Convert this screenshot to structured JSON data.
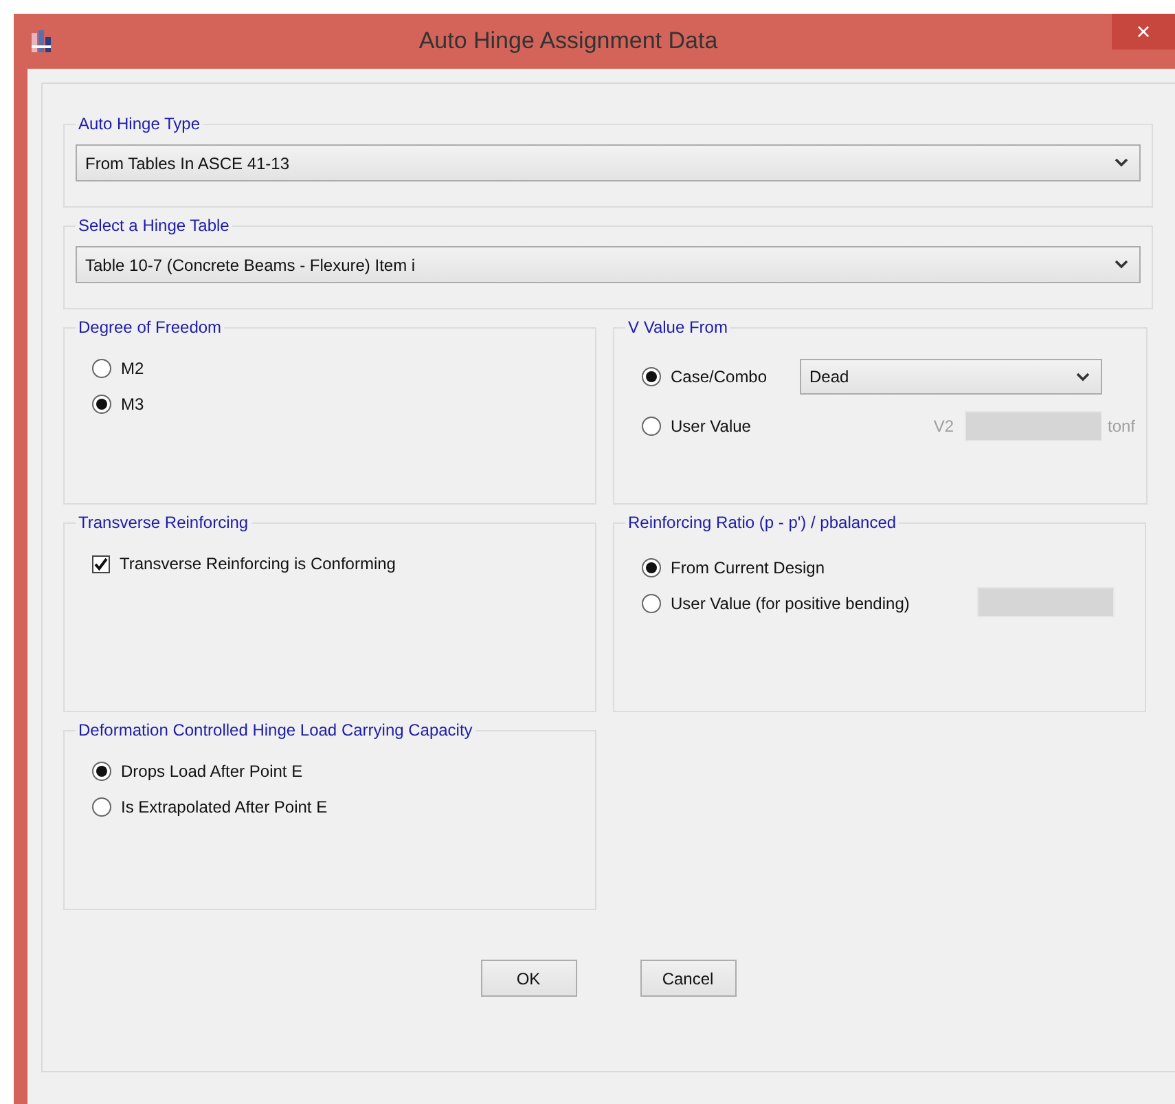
{
  "window": {
    "title": "Auto Hinge Assignment Data",
    "close": "×"
  },
  "auto_hinge_type": {
    "title": "Auto Hinge Type",
    "value": "From Tables In ASCE 41-13"
  },
  "hinge_table": {
    "title": "Select a Hinge Table",
    "value": "Table 10-7 (Concrete Beams - Flexure) Item i"
  },
  "degree_of_freedom": {
    "title": "Degree of Freedom",
    "options": [
      {
        "label": "M2",
        "selected": false
      },
      {
        "label": "M3",
        "selected": true
      }
    ]
  },
  "v_value_from": {
    "title": "V Value From",
    "options": [
      {
        "label": "Case/Combo",
        "selected": true
      },
      {
        "label": "User Value",
        "selected": false
      }
    ],
    "case_combo": {
      "value": "Dead"
    },
    "user_value": {
      "label": "V2",
      "unit": "tonf",
      "disabled": true
    }
  },
  "transverse_reinforcing": {
    "title": "Transverse Reinforcing",
    "checkbox": {
      "label": "Transverse Reinforcing is Conforming",
      "checked": true
    }
  },
  "reinforcing_ratio": {
    "title": "Reinforcing Ratio  (p - p') / pbalanced",
    "options": [
      {
        "label": "From Current Design",
        "selected": true
      },
      {
        "label": "User Value (for positive bending)",
        "selected": false
      }
    ],
    "user_value": {
      "disabled": true
    }
  },
  "deformation_capacity": {
    "title": "Deformation Controlled Hinge Load Carrying Capacity",
    "options": [
      {
        "label": "Drops Load After Point E",
        "selected": true
      },
      {
        "label": "Is Extrapolated After Point E",
        "selected": false
      }
    ]
  },
  "buttons": [
    "OK",
    "Cancel"
  ]
}
